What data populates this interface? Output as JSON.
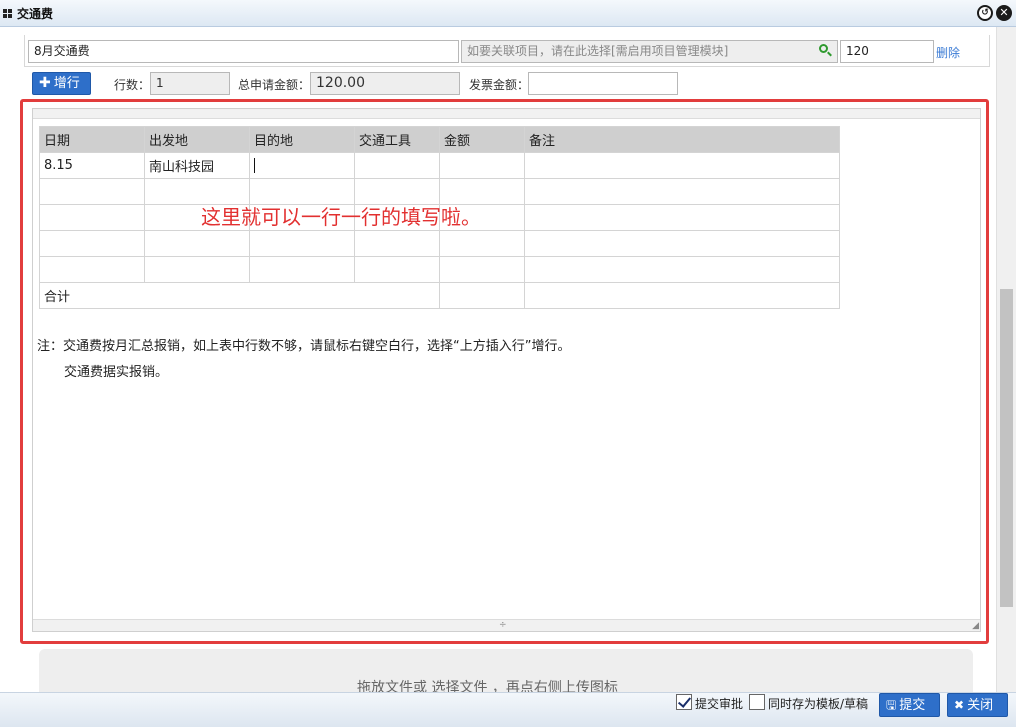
{
  "window": {
    "title": "交通费"
  },
  "form": {
    "subject_value": "8月交通费",
    "project_placeholder": "如要关联项目，请在此选择[需启用项目管理模块]",
    "amount_value": "120",
    "delete_label": "删除",
    "add_row_label": "增行",
    "rows_label": "行数：",
    "rows_value": "1",
    "total_label": "总申请金额：",
    "total_value": "120.00",
    "invoice_label": "发票金额：",
    "invoice_value": ""
  },
  "table": {
    "headers": [
      "日期",
      "出发地",
      "目的地",
      "交通工具",
      "金额",
      "备注"
    ],
    "rows": [
      [
        "8.15",
        "南山科技园",
        "",
        "",
        "",
        ""
      ],
      [
        "",
        "",
        "",
        "",
        "",
        ""
      ],
      [
        "",
        "",
        "",
        "",
        "",
        ""
      ],
      [
        "",
        "",
        "",
        "",
        "",
        ""
      ],
      [
        "",
        "",
        "",
        "",
        "",
        ""
      ]
    ],
    "total_label": "合计"
  },
  "annotation": "这里就可以一行一行的填写啦。",
  "notes": {
    "line1": "注：交通费按月汇总报销，如上表中行数不够，请鼠标右键空白行，选择“上方插入行”增行。",
    "line2": "交通费据实报销。"
  },
  "upload": {
    "hint": "拖放文件或 选择文件 ，再点右侧上传图标"
  },
  "footer": {
    "submit_approval_label": "提交审批",
    "submit_approval_checked": true,
    "save_template_label": "同时存为模板/草稿",
    "save_template_checked": false,
    "submit_label": "提交",
    "close_label": "关闭"
  },
  "colors": {
    "accent": "#2e6fc9",
    "highlight_border": "#e23d3d",
    "annotation_text": "#e23030"
  },
  "icons": [
    "grid-icon",
    "restore-icon",
    "close-icon",
    "search-icon",
    "plus-icon",
    "save-icon",
    "x-icon"
  ]
}
